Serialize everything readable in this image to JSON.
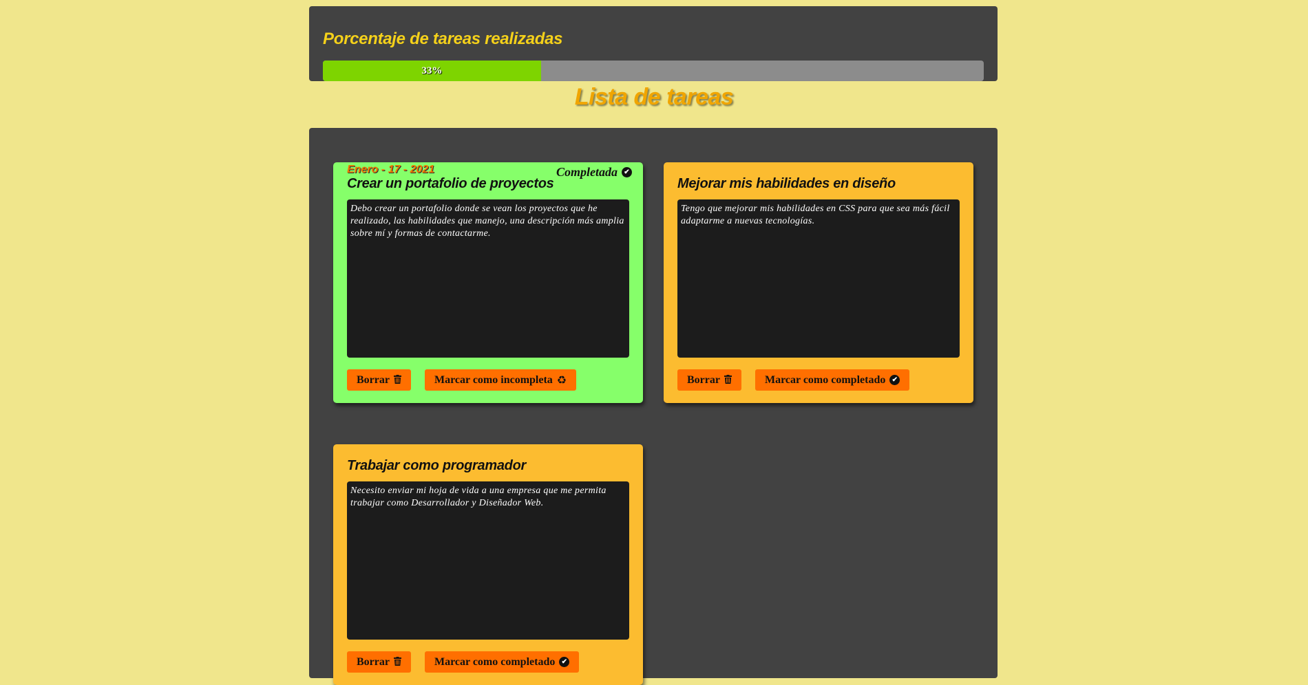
{
  "progress": {
    "title": "Porcentaje de tareas realizadas",
    "percent": 33,
    "label": "33%",
    "fill_color": "#7ed400"
  },
  "list_title": "Lista de tareas",
  "colors": {
    "background": "#f0e68c",
    "panel": "#424242",
    "done_card": "#86ff6a",
    "pending_card": "#fcbc30",
    "button": "#ff6f00"
  },
  "tasks": [
    {
      "date": "Enero - 17 - 2021",
      "status": "Completada",
      "title": "Crear un portafolio de proyectos",
      "description": "Debo crear un portafolio donde se vean los proyectos que he realizado, las habilidades que manejo, una descripción más amplia sobre mí y formas de contactarme.",
      "delete_label": "Borrar",
      "toggle_label": "Marcar como incompleta",
      "toggle_icon": "recycle-icon"
    },
    {
      "title": "Mejorar mis habilidades en diseño",
      "description": "Tengo que mejorar mis habilidades en CSS para que sea más fácil adaptarme a nuevas tecnologías.",
      "delete_label": "Borrar",
      "toggle_label": "Marcar como completado",
      "toggle_icon": "check-circle-icon"
    },
    {
      "title": "Trabajar como programador",
      "description": "Necesito enviar mi hoja de vida a una empresa que me permita trabajar como Desarrollador y Diseñador Web.",
      "delete_label": "Borrar",
      "toggle_label": "Marcar como completado",
      "toggle_icon": "check-circle-icon"
    }
  ]
}
